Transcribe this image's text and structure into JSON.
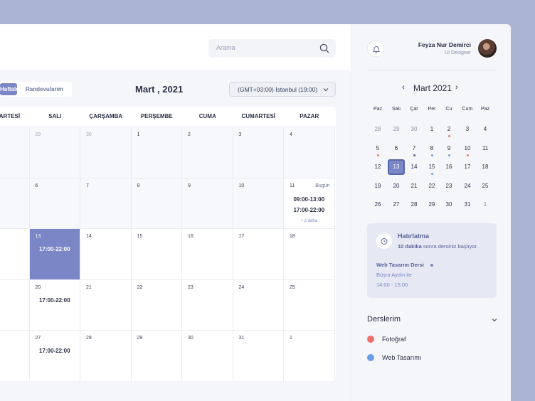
{
  "header": {
    "search_placeholder": "Arama"
  },
  "toolbar": {
    "view_active": "Haftalık",
    "view_other": "Randevularım",
    "month_title": "Mart , 2021",
    "timezone": "(GMT+03:00) İstanbul (19:00)"
  },
  "calendar": {
    "weekdays": [
      "PAZARTESİ",
      "SALI",
      "ÇARŞAMBA",
      "PERŞEMBE",
      "CUMA",
      "CUMARTESİ",
      "PAZAR"
    ],
    "weeks": [
      [
        {
          "d": ""
        },
        {
          "d": "29",
          "faded": true
        },
        {
          "d": "30",
          "faded": true
        },
        {
          "d": "1"
        },
        {
          "d": "2"
        },
        {
          "d": "3"
        },
        {
          "d": "4"
        }
      ],
      [
        {
          "d": ""
        },
        {
          "d": "6"
        },
        {
          "d": "7"
        },
        {
          "d": "8"
        },
        {
          "d": "9"
        },
        {
          "d": "10"
        },
        {
          "d": "11",
          "today": "Bugün",
          "times": [
            "09:00-13:00",
            "17:00-22:00"
          ],
          "more": "+ 2 daha"
        }
      ],
      [
        {
          "d": ""
        },
        {
          "d": "13",
          "selected": true,
          "times": [
            "17:00-22:00"
          ]
        },
        {
          "d": "14"
        },
        {
          "d": "15"
        },
        {
          "d": "16"
        },
        {
          "d": "17"
        },
        {
          "d": "18"
        }
      ],
      [
        {
          "d": ""
        },
        {
          "d": "20",
          "times": [
            "17:00-22:00"
          ]
        },
        {
          "d": "21"
        },
        {
          "d": "22"
        },
        {
          "d": "23"
        },
        {
          "d": "24"
        },
        {
          "d": "25"
        }
      ],
      [
        {
          "d": ""
        },
        {
          "d": "27",
          "times": [
            "17:00-22:00"
          ]
        },
        {
          "d": "28"
        },
        {
          "d": "29"
        },
        {
          "d": "30"
        },
        {
          "d": "31"
        },
        {
          "d": "1"
        }
      ]
    ]
  },
  "user": {
    "name": "Feyza Nur Demirci",
    "role": "UI Designer"
  },
  "mini_calendar": {
    "title": "Mart 2021",
    "weekdays": [
      "Paz",
      "Salı",
      "Çar",
      "Per",
      "Cu",
      "Cum",
      "Paz"
    ],
    "days": [
      [
        {
          "d": "28",
          "faded": true
        },
        {
          "d": "29",
          "faded": true
        },
        {
          "d": "30",
          "faded": true
        },
        {
          "d": "1"
        },
        {
          "d": "2",
          "dot": "#e8736c"
        },
        {
          "d": "3"
        },
        {
          "d": "4"
        }
      ],
      [
        {
          "d": "5",
          "dot": "#e8736c"
        },
        {
          "d": "6"
        },
        {
          "d": "7",
          "dot": "#5a6180"
        },
        {
          "d": "8",
          "dot": "#6b9ee8"
        },
        {
          "d": "9",
          "dot": "#6b9ee8"
        },
        {
          "d": "10",
          "dot": "#e8736c"
        },
        {
          "d": "11"
        }
      ],
      [
        {
          "d": "12"
        },
        {
          "d": "13",
          "selected": true
        },
        {
          "d": "14"
        },
        {
          "d": "15",
          "dot": "#6b9ee8"
        },
        {
          "d": "16"
        },
        {
          "d": "17"
        },
        {
          "d": "18"
        }
      ],
      [
        {
          "d": "19"
        },
        {
          "d": "20"
        },
        {
          "d": "21"
        },
        {
          "d": "22"
        },
        {
          "d": "23"
        },
        {
          "d": "24"
        },
        {
          "d": "25"
        }
      ],
      [
        {
          "d": "26"
        },
        {
          "d": "27"
        },
        {
          "d": "28"
        },
        {
          "d": "29"
        },
        {
          "d": "30"
        },
        {
          "d": "31"
        },
        {
          "d": "1",
          "next": true
        }
      ]
    ]
  },
  "reminder": {
    "title": "Hatırlatma",
    "sub_bold": "10 dakika",
    "sub_rest": " sonra dersiniz başlıyor.",
    "course": "Web Tasarım Dersi",
    "teacher": "Büşra Aydın ile",
    "time": "14:00 - 15:00"
  },
  "courses": {
    "title": "Derslerim",
    "items": [
      {
        "label": "Fotoğraf",
        "color": "#ef6f6c"
      },
      {
        "label": "Web Tasarımı",
        "color": "#6b9ee8"
      }
    ]
  },
  "colors": {
    "accent": "#7a86c6",
    "red": "#ef6f6c",
    "blue": "#6b9ee8"
  }
}
